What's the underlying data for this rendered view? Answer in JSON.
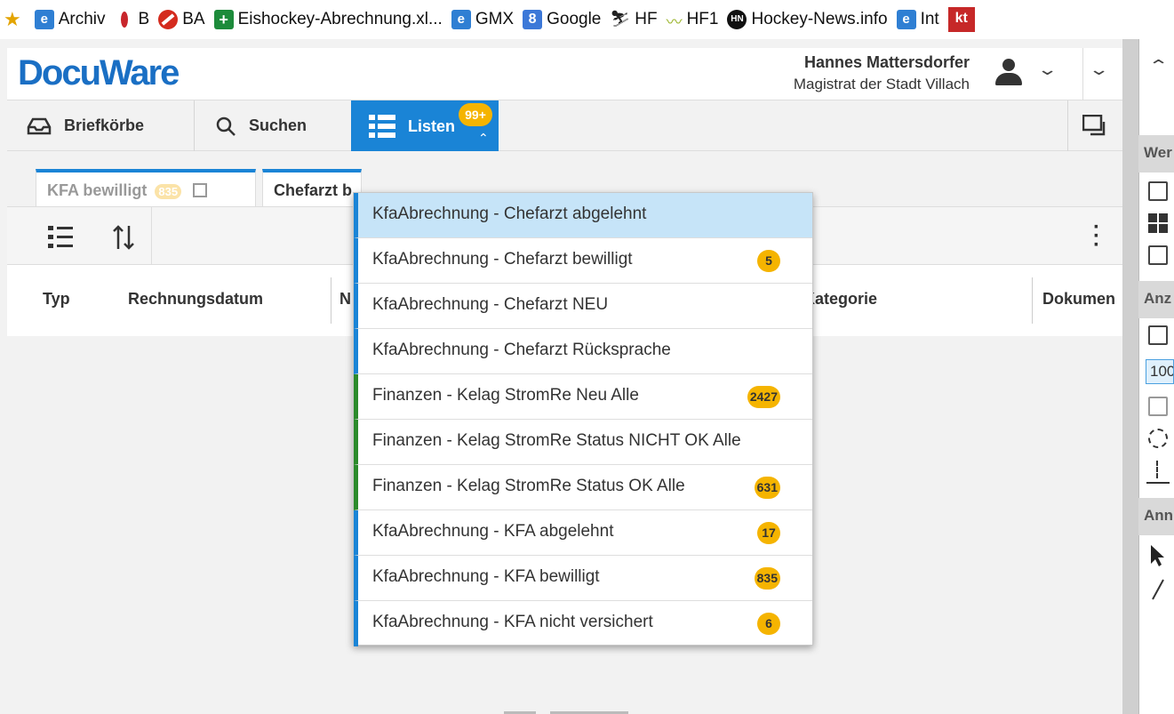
{
  "favorites": [
    {
      "icon": "star-icon",
      "label": ""
    },
    {
      "icon": "ie-icon",
      "label": "Archiv"
    },
    {
      "icon": "flame-icon",
      "label": "B"
    },
    {
      "icon": "no-entry-icon",
      "label": "BA"
    },
    {
      "icon": "green-cross-icon",
      "label": "Eishockey-Abrechnung.xl..."
    },
    {
      "icon": "ie-icon",
      "label": "GMX"
    },
    {
      "icon": "google-icon",
      "label": "Google"
    },
    {
      "icon": "hf-icon",
      "label": "HF"
    },
    {
      "icon": "hf1-icon",
      "label": "HF1"
    },
    {
      "icon": "hockey-news-icon",
      "label": "Hockey-News.info"
    },
    {
      "icon": "ie-icon",
      "label": "Int"
    },
    {
      "icon": "kt-icon",
      "label": "kt"
    }
  ],
  "header": {
    "logo": "DocuWare",
    "user_name": "Hannes Mattersdorfer",
    "user_org": "Magistrat der Stadt Villach"
  },
  "toolbar": {
    "briefkoerbe": "Briefkörbe",
    "suchen": "Suchen",
    "listen": "Listen",
    "listen_badge": "99+"
  },
  "tabs": [
    {
      "label": "KFA bewilligt",
      "badge": "835"
    },
    {
      "label": "Chefarzt b"
    }
  ],
  "columns": [
    "Typ",
    "Rechnungsdatum",
    "N",
    "Kategorie",
    "Dokumen"
  ],
  "dropdown": [
    {
      "label": "KfaAbrechnung - Chefarzt abgelehnt",
      "badge": "",
      "color": "#1a84d6"
    },
    {
      "label": "KfaAbrechnung - Chefarzt bewilligt",
      "badge": "5",
      "color": "#1a84d6"
    },
    {
      "label": "KfaAbrechnung - Chefarzt NEU",
      "badge": "",
      "color": "#1a84d6"
    },
    {
      "label": "KfaAbrechnung - Chefarzt Rücksprache",
      "badge": "",
      "color": "#1a84d6"
    },
    {
      "label": "Finanzen - Kelag StromRe Neu Alle",
      "badge": "2427",
      "color": "#2b8a2b"
    },
    {
      "label": "Finanzen - Kelag StromRe Status NICHT OK Alle",
      "badge": "",
      "color": "#2b8a2b"
    },
    {
      "label": "Finanzen - Kelag StromRe Status OK Alle",
      "badge": "631",
      "color": "#2b8a2b"
    },
    {
      "label": "KfaAbrechnung - KFA abgelehnt",
      "badge": "17",
      "color": "#1a84d6"
    },
    {
      "label": "KfaAbrechnung - KFA bewilligt",
      "badge": "835",
      "color": "#1a84d6"
    },
    {
      "label": "KfaAbrechnung - KFA nicht versichert",
      "badge": "6",
      "color": "#1a84d6"
    }
  ],
  "right_panel": {
    "section1": "Wer",
    "section2": "Anz",
    "zoom": "100",
    "section3": "Ann"
  }
}
